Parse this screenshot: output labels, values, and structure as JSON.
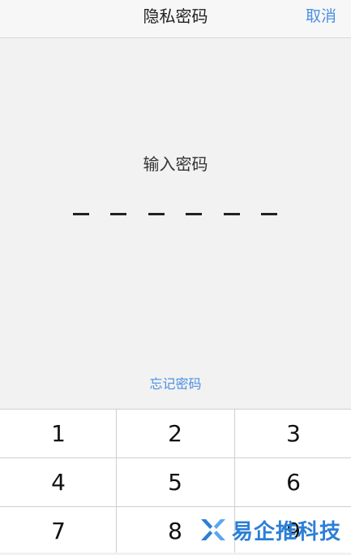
{
  "nav": {
    "title": "隐私密码",
    "cancel_label": "取消"
  },
  "prompt": "输入密码",
  "pin": {
    "length": 6,
    "entered": 0
  },
  "forgot_label": "忘记密码",
  "keypad": {
    "keys": [
      "1",
      "2",
      "3",
      "4",
      "5",
      "6",
      "7",
      "8",
      "9"
    ]
  },
  "watermark": {
    "text": "易企推科技"
  },
  "colors": {
    "accent": "#4a90e2",
    "watermark": "#2c7fd6"
  }
}
